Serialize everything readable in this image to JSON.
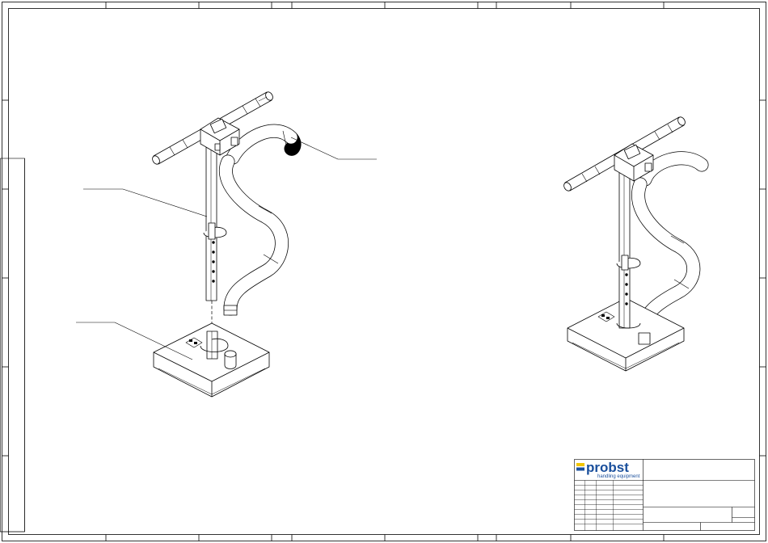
{
  "title_block": {
    "brand_name": "probst",
    "brand_tagline": "handling equipment",
    "brand_color": "#1a4f9c",
    "brand_accent": "#f2c500"
  },
  "icons": [
    "probst-logo-icon"
  ]
}
